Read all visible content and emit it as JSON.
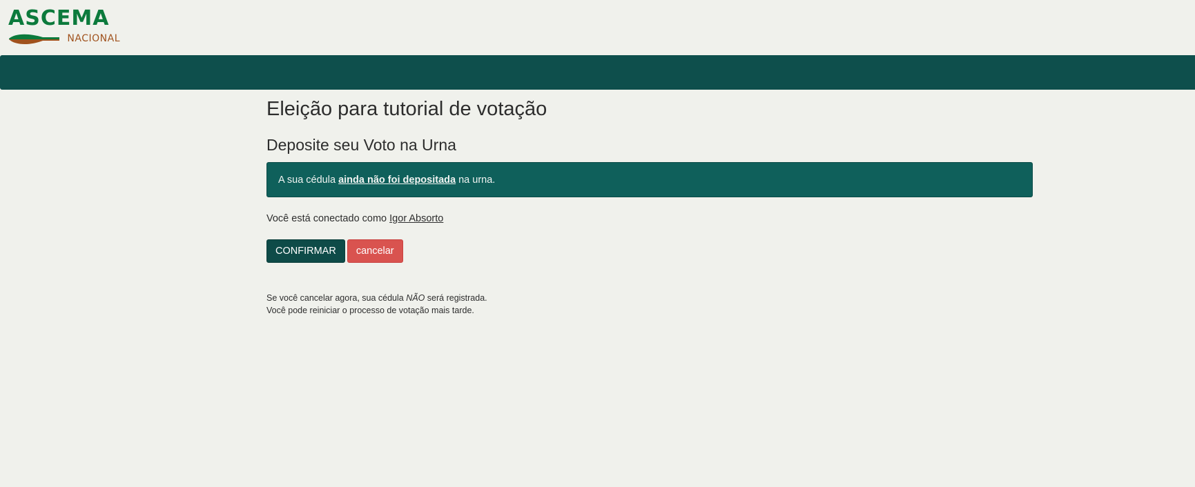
{
  "colors": {
    "page_background": "#f0f1ec",
    "brand_green": "#0c7a3c",
    "brand_brown": "#a0521d",
    "navbar": "#0e4f4c",
    "alert_background": "#0f605b",
    "confirm_button": "#0e4b48",
    "cancel_button": "#d9534f"
  },
  "logo": {
    "name": "ASCEMA",
    "subtitle": "NACIONAL",
    "icon": "leaf-icon"
  },
  "page": {
    "title": "Eleição para tutorial de votação",
    "subtitle": "Deposite seu Voto na Urna"
  },
  "alert": {
    "prefix": "A sua cédula ",
    "emphasis": "ainda não foi depositada",
    "suffix": " na urna."
  },
  "session": {
    "prefix": "Você está conectado como ",
    "user_name": "Igor Absorto"
  },
  "buttons": {
    "confirm_label": "CONFIRMAR",
    "cancel_label": "cancelar"
  },
  "note": {
    "line1_prefix": "Se você cancelar agora, sua cédula ",
    "line1_emphasis": "NÃO",
    "line1_suffix": " será registrada.",
    "line2": "Você pode reiniciar o processo de votação mais tarde."
  }
}
